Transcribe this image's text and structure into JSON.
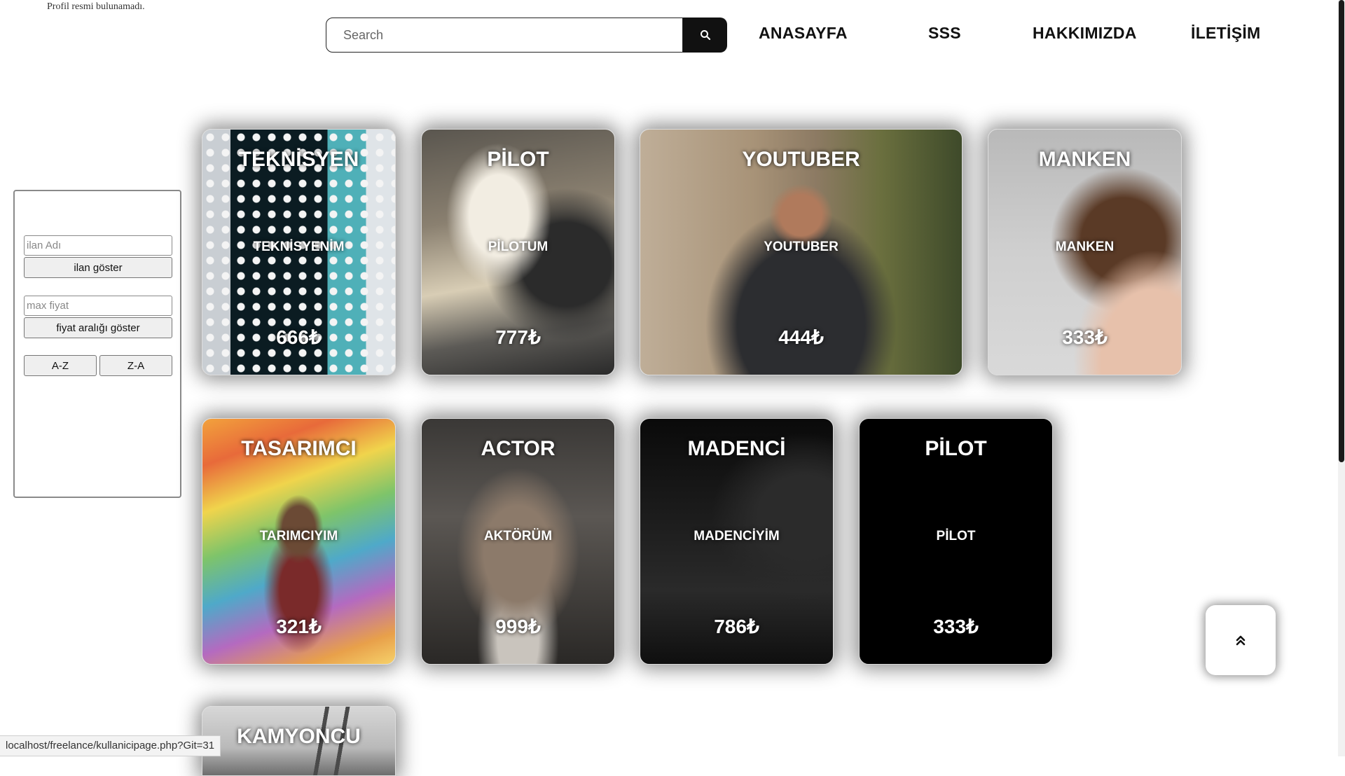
{
  "profile": {
    "missing_text": "Profil resmi bulunamadı."
  },
  "search": {
    "placeholder": "Search"
  },
  "nav": {
    "items": [
      "ANASAYFA",
      "SSS",
      "HAKKIMIZDA",
      "İLETİŞİM"
    ]
  },
  "filter": {
    "ilan_placeholder": "ilan Adı",
    "ilan_button": "ilan göster",
    "fiyat_placeholder": "max fiyat",
    "fiyat_button": "fiyat aralığı göster",
    "sort_az": "A-Z",
    "sort_za": "Z-A"
  },
  "cards": [
    {
      "title": "TEKNİSYEN",
      "desc": "TEKNİSYENİM",
      "price": "666₺"
    },
    {
      "title": "PİLOT",
      "desc": "PİLOTUM",
      "price": "777₺"
    },
    {
      "title": "YOUTUBER",
      "desc": "YOUTUBER",
      "price": "444₺"
    },
    {
      "title": "MANKEN",
      "desc": "MANKEN",
      "price": "333₺"
    },
    {
      "title": "TASARIMCI",
      "desc": "TARIMCIYIM",
      "price": "321₺"
    },
    {
      "title": "ACTOR",
      "desc": "AKTÖRÜM",
      "price": "999₺"
    },
    {
      "title": "MADENCİ",
      "desc": "MADENCİYİM",
      "price": "786₺"
    },
    {
      "title": "PİLOT",
      "desc": "PİLOT",
      "price": "333₺"
    },
    {
      "title": "KAMYONCU",
      "desc": "",
      "price": ""
    }
  ],
  "scroll_top": {
    "icon": "double-chevron-up-icon"
  },
  "status_bar": {
    "url": "localhost/freelance/kullanicipage.php?Git=31"
  },
  "colors": {
    "accent": "#111111",
    "background": "#ffffff"
  }
}
